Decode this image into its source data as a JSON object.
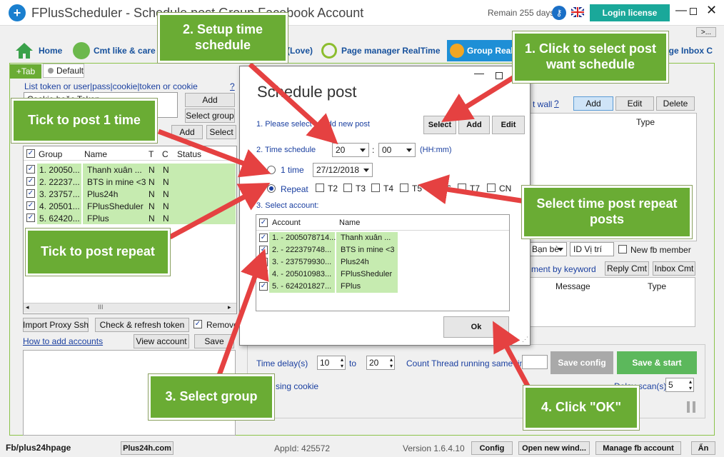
{
  "window": {
    "title": "FPlusScheduler - Schedule post Group Facebook Account",
    "remain": "Remain 255 days",
    "login_label": "Login license",
    "more_label": ">...",
    "status_left": "Fb/plus24hpage",
    "status_site": "Plus24h.com",
    "appid": "AppId: 425572",
    "version": "Version 1.6.4.10",
    "config_label": "Config",
    "open_new_label": "Open new wind...",
    "manage_label": "Manage fb account",
    "an_label": "Ẩn"
  },
  "tabs": [
    {
      "label": "Home"
    },
    {
      "label": "Cmt like & care"
    },
    {
      "label": "(Love)"
    },
    {
      "label": "Page manager RealTime"
    },
    {
      "label": "Group Real"
    },
    {
      "label": "age Inbox C"
    }
  ],
  "left": {
    "plus_tab": "+Tab",
    "default_tab": "Default",
    "token_label": "List token or user|pass|cookie|token or cookie",
    "help": "?",
    "token_value": "Cookie hoặc Token",
    "add_label": "Add",
    "select_group_label": "Select group",
    "add2_label": "Add",
    "select_label": "Select",
    "columns": [
      "Group",
      "Name",
      "T",
      "C",
      "Status"
    ],
    "rows": [
      {
        "group": "1. 20050...",
        "name": "Thanh xuân ...",
        "t": "N",
        "c": "N"
      },
      {
        "group": "2. 22237...",
        "name": "BTS in mine <3",
        "t": "N",
        "c": "N"
      },
      {
        "group": "3. 23757...",
        "name": "Plus24h",
        "t": "N",
        "c": "N"
      },
      {
        "group": "4. 20501...",
        "name": "FPlusSheduler",
        "t": "N",
        "c": "N"
      },
      {
        "group": "5. 62420...",
        "name": "FPlus",
        "t": "N",
        "c": "N"
      }
    ],
    "scroll_mark": "III",
    "import_label": "Import Proxy Ssh",
    "check_label": "Check & refresh token",
    "remove_label": "Remove",
    "howto_label": "How to add accounts",
    "view_label": "View account",
    "save_label": "Save"
  },
  "right": {
    "wall_label": "t wall",
    "help": "?",
    "add_label": "Add",
    "edit_label": "Edit",
    "delete_label": "Delete",
    "type_col": "Type",
    "ban_be": "Bạn bè",
    "id_vitri": "ID Vị trí",
    "new_member": "New fb member",
    "comment_keyword": "ment by keyword",
    "reply_label": "Reply Cmt",
    "inbox_label": "Inbox Cmt",
    "message_col": "Message",
    "type_col2": "Type",
    "time_delay": "Time delay(s)",
    "delay_from": "10",
    "to_label": "to",
    "delay_to": "20",
    "count_thread": "Count Thread running same time",
    "save_config": "Save config",
    "save_start": "Save & start",
    "using_cookie": "sing cookie",
    "delay_scan": "Delay scan(s)",
    "delay_scan_val": "5"
  },
  "dialog": {
    "title": "Schedule post",
    "step1": "1. Please select or add new post",
    "select_label": "Select",
    "add_label": "Add",
    "edit_label": "Edit",
    "step2": "2. Time schedule",
    "hour": "20",
    "colon": ":",
    "minute": "00",
    "hhmm": "(HH:mm)",
    "one_time": "1 time",
    "date": "27/12/2018",
    "repeat": "Repeat",
    "days": [
      "T2",
      "T3",
      "T4",
      "T5",
      "T6",
      "T7",
      "CN"
    ],
    "step3": "3. Select account:",
    "acc_cols": [
      "Account",
      "Name"
    ],
    "accounts": [
      {
        "account": "1. - 2005078714...",
        "name": "Thanh xuân ..."
      },
      {
        "account": "2. - 222379748...",
        "name": "BTS in mine <3"
      },
      {
        "account": "3. - 237579930...",
        "name": "Plus24h"
      },
      {
        "account": "4. - 205010983...",
        "name": "FPlusSheduler"
      },
      {
        "account": "5. - 624201827...",
        "name": "FPlus"
      }
    ],
    "ok_label": "Ok"
  },
  "callouts": {
    "c1": "2. Setup time schedule",
    "c2": "1. Click to select post want schedule",
    "c3": "Tick to post 1 time",
    "c4": "Select time post repeat posts",
    "c5": "Tick to post repeat",
    "c6": "3. Select group",
    "c7": "4. Click \"OK\""
  },
  "colors": {
    "accent_green": "#6aac34",
    "login_bg": "#1aa89a",
    "arrow_red": "#e54141",
    "row_green": "#c6ebb0",
    "save_start_bg": "#5cb85c"
  }
}
